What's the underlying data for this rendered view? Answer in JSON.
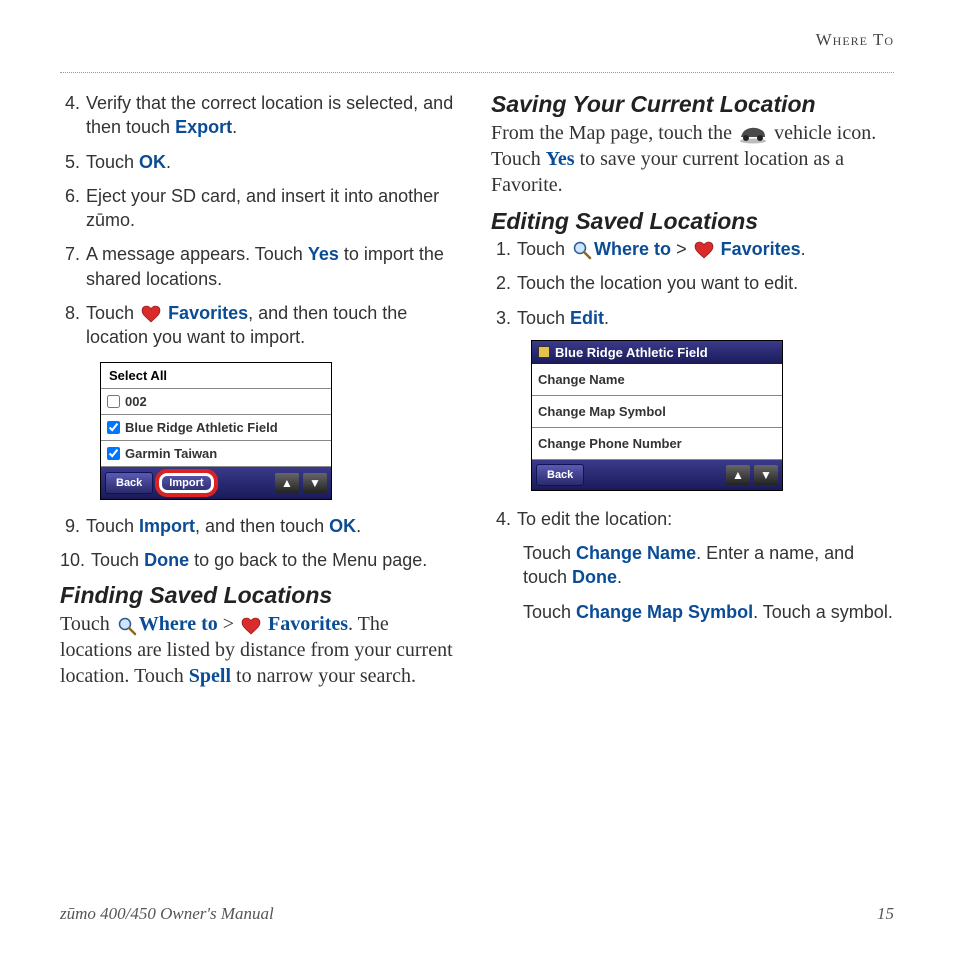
{
  "header": {
    "section": "Where To"
  },
  "left": {
    "steps": [
      {
        "n": "4.",
        "pre": "Verify that the correct location is selected, and then touch ",
        "bold": "Export",
        "post": "."
      },
      {
        "n": "5.",
        "pre": "Touch ",
        "bold": "OK",
        "post": "."
      },
      {
        "n": "6.",
        "plain": "Eject your SD card, and insert it into another zūmo."
      },
      {
        "n": "7.",
        "pre": "A message appears. Touch ",
        "bold": "Yes",
        "post": " to import the shared locations."
      },
      {
        "n": "8.",
        "pre": "Touch ",
        "bold": "Favorites",
        "post": ", and then touch the location you want to import."
      },
      {
        "n": "9.",
        "pre": "Touch ",
        "bold": "Import",
        "mid": ", and then touch ",
        "bold2": "OK",
        "post": "."
      },
      {
        "n": "10.",
        "pre": "Touch ",
        "bold": "Done",
        "post": " to go back to the Menu page."
      }
    ],
    "screenshot": {
      "title": "Select All",
      "items": [
        {
          "label": "002",
          "checked": false
        },
        {
          "label": "Blue Ridge Athletic Field",
          "checked": true
        },
        {
          "label": "Garmin Taiwan",
          "checked": true
        }
      ],
      "back": "Back",
      "import": "Import"
    },
    "subhead": "Finding Saved Locations",
    "finding": {
      "pre": "Touch ",
      "where": "Where to",
      "gt": " > ",
      "fav": "Favorites",
      "post1": ". The locations are listed by distance from your current location. Touch ",
      "spell": "Spell",
      "post2": " to narrow your search."
    }
  },
  "right": {
    "subhead1": "Saving Your Current Location",
    "saving": {
      "pre": "From the Map page, touch the ",
      "mid": " vehicle icon. Touch ",
      "yes": "Yes",
      "post": " to save your current location as a Favorite."
    },
    "subhead2": "Editing Saved Locations",
    "esteps": {
      "s1": {
        "n": "1.",
        "pre": "Touch ",
        "where": "Where to",
        "gt": " > ",
        "fav": "Favorites",
        "post": "."
      },
      "s2": {
        "n": "2.",
        "plain": "Touch the location you want to edit."
      },
      "s3": {
        "n": "3.",
        "pre": "Touch ",
        "bold": "Edit",
        "post": "."
      },
      "s4": {
        "n": "4.",
        "plain": "To edit the location:"
      }
    },
    "screenshot": {
      "title": "Blue Ridge Athletic Field",
      "rows": [
        "Change Name",
        "Change Map Symbol",
        "Change Phone Number"
      ],
      "back": "Back"
    },
    "edit_sub1": {
      "pre": "Touch ",
      "bold": "Change Name",
      "mid": ". Enter a name, and touch ",
      "bold2": "Done",
      "post": "."
    },
    "edit_sub2": {
      "pre": "Touch ",
      "bold": "Change Map Symbol",
      "post": ". Touch a symbol."
    }
  },
  "footer": {
    "left": "zūmo 400/450 Owner's Manual",
    "right": "15"
  }
}
